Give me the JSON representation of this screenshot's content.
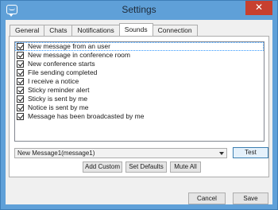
{
  "window": {
    "title": "Settings",
    "close_glyph": "✕"
  },
  "tabs": [
    {
      "label": "General"
    },
    {
      "label": "Chats"
    },
    {
      "label": "Notifications"
    },
    {
      "label": "Sounds",
      "active": true
    },
    {
      "label": "Connection"
    }
  ],
  "sounds_list": [
    {
      "label": "New message from an user",
      "checked": true
    },
    {
      "label": "New message in conference room",
      "checked": true
    },
    {
      "label": "New conference starts",
      "checked": true
    },
    {
      "label": "File sending completed",
      "checked": true
    },
    {
      "label": "I receive a notice",
      "checked": true
    },
    {
      "label": "Sticky reminder alert",
      "checked": true
    },
    {
      "label": "Sticky is sent by me",
      "checked": true
    },
    {
      "label": "Notice is sent by me",
      "checked": true
    },
    {
      "label": "Message has been broadcasted by me",
      "checked": true
    }
  ],
  "sound_select": {
    "value": "New Message1(message1)"
  },
  "buttons": {
    "test": "Test",
    "add_custom": "Add Custom",
    "set_defaults": "Set Defaults",
    "mute_all": "Mute All",
    "cancel": "Cancel",
    "save": "Save"
  },
  "icons": {
    "app": "chat-bubble-icon",
    "dropdown": "chevron-down-icon"
  },
  "colors": {
    "titlebar": "#5fa0d8",
    "close": "#c7402f"
  }
}
